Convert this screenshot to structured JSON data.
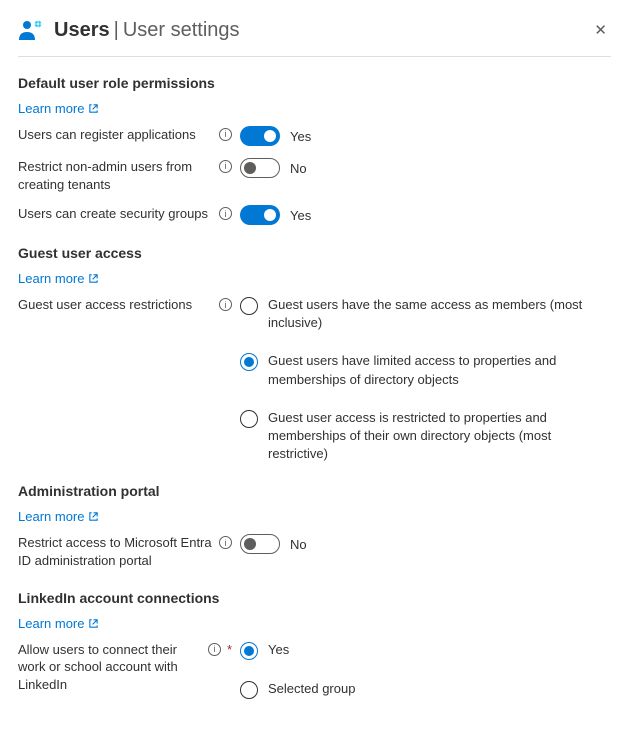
{
  "header": {
    "title_main": "Users",
    "title_sub": "User settings"
  },
  "sections": {
    "default_role": {
      "title": "Default user role permissions",
      "learn_more": "Learn more",
      "settings": {
        "register_apps": {
          "label": "Users can register applications",
          "value_label": "Yes"
        },
        "restrict_tenants": {
          "label": "Restrict non-admin users from creating tenants",
          "value_label": "No"
        },
        "security_groups": {
          "label": "Users can create security groups",
          "value_label": "Yes"
        }
      }
    },
    "guest_access": {
      "title": "Guest user access",
      "learn_more": "Learn more",
      "label": "Guest user access restrictions",
      "options": {
        "o0": "Guest users have the same access as members (most inclusive)",
        "o1": "Guest users have limited access to properties and memberships of directory objects",
        "o2": "Guest user access is restricted to properties and memberships of their own directory objects (most restrictive)"
      }
    },
    "admin_portal": {
      "title": "Administration portal",
      "learn_more": "Learn more",
      "settings": {
        "restrict_portal": {
          "label": "Restrict access to Microsoft Entra ID administration portal",
          "value_label": "No"
        }
      }
    },
    "linkedin": {
      "title": "LinkedIn account connections",
      "learn_more": "Learn more",
      "label": "Allow users to connect their work or school account with LinkedIn",
      "options": {
        "o0": "Yes",
        "o1": "Selected group"
      }
    }
  }
}
